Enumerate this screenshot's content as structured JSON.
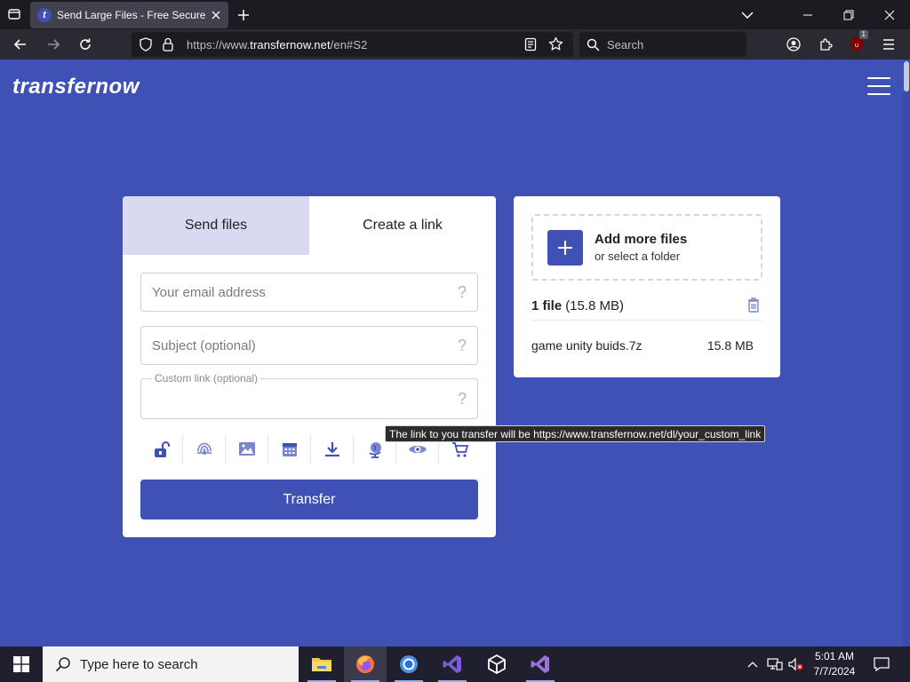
{
  "browser": {
    "tab_title": "Send Large Files - Free Secure File",
    "favicon_letter": "t",
    "url_prefix": "https://www.",
    "url_host": "transfernow.net",
    "url_path": "/en#S2",
    "search_placeholder": "Search",
    "extension_badge": "1"
  },
  "site": {
    "logo": "transfernow",
    "tabs": [
      "Send files",
      "Create a link"
    ],
    "form": {
      "email_placeholder": "Your email address",
      "subject_placeholder": "Subject (optional)",
      "custom_link_label": "Custom link (optional)",
      "help_glyph": "?"
    },
    "option_icons": [
      "lock-open-icon",
      "fingerprint-icon",
      "image-icon",
      "calendar-icon",
      "download-icon",
      "globe-icon",
      "eye-icon",
      "cart-icon"
    ],
    "transfer_button": "Transfer",
    "files_panel": {
      "add_title": "Add more files",
      "add_sub": "or select a folder",
      "file_count": "1 file",
      "total_size": "(15.8 MB)",
      "files": [
        {
          "name": "game unity buids.7z",
          "size": "15.8 MB"
        }
      ]
    },
    "tooltip": "The link to you transfer will be https://www.transfernow.net/dl/your_custom_link",
    "accent_color": "#3f51b5"
  },
  "taskbar": {
    "search_placeholder": "Type here to search",
    "time": "5:01 AM",
    "date": "7/7/2024",
    "apps": [
      "file-explorer-icon",
      "firefox-icon",
      "chrome-icon",
      "visual-studio-code-icon",
      "unity-icon",
      "visual-studio-icon"
    ]
  }
}
